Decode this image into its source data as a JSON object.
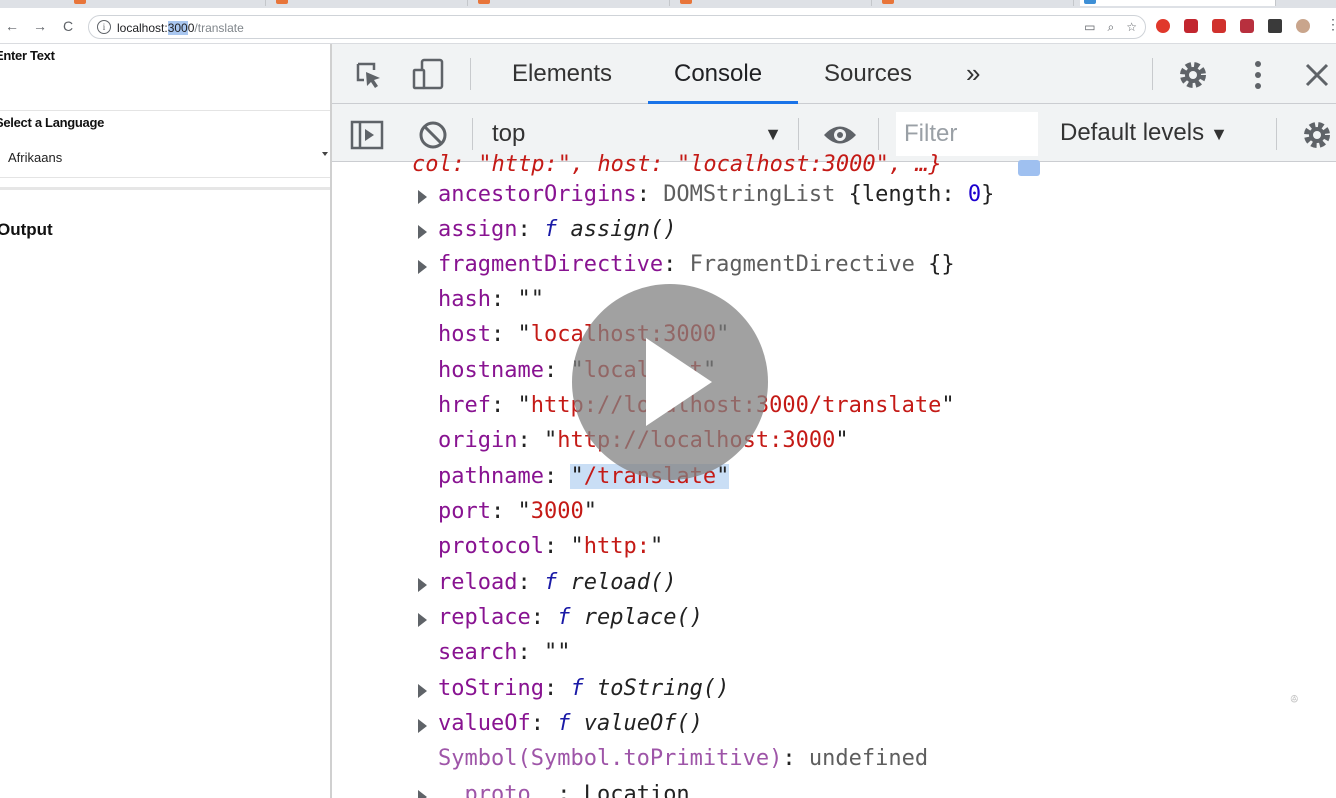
{
  "browser": {
    "url_host": "localhost:",
    "url_port": "300",
    "url_port_tail": "0",
    "url_path": "/translate"
  },
  "page": {
    "enter_text_label": "Enter Text",
    "select_language_label": "Select a Language",
    "language_value": "Afrikaans",
    "output_heading": "Output"
  },
  "devtools": {
    "tabs": [
      "Elements",
      "Console",
      "Sources"
    ],
    "more_tabs": "»",
    "context": "top",
    "filter_placeholder": "Filter",
    "levels_label": "Default levels",
    "console_lines": {
      "partial": "col: \"http:\", host: \"localhost:3000\", …}",
      "ancestorOrigins_key": "ancestorOrigins",
      "ancestorOrigins_type": "DOMStringList",
      "ancestorOrigins_len_key": "length",
      "ancestorOrigins_len_val": "0",
      "assign_key": "assign",
      "assign_fn": "assign()",
      "fragment_key": "fragmentDirective",
      "fragment_val": "FragmentDirective",
      "hash_key": "hash",
      "hash_val": "\"\"",
      "host_key": "host",
      "host_val": "localhost:3000",
      "hostname_key": "hostname",
      "hostname_val": "localhost",
      "href_key": "href",
      "href_val": "http://localhost:3000/translate",
      "origin_key": "origin",
      "origin_val": "http://localhost:3000",
      "pathname_key": "pathname",
      "pathname_val": "/translate",
      "port_key": "port",
      "port_val": "3000",
      "protocol_key": "protocol",
      "protocol_val": "http:",
      "reload_key": "reload",
      "reload_fn": "reload()",
      "replace_key": "replace",
      "replace_fn": "replace()",
      "search_key": "search",
      "search_val": "\"\"",
      "toString_key": "toString",
      "toString_fn": "toString()",
      "valueOf_key": "valueOf",
      "valueOf_fn": "valueOf()",
      "symbol_key": "Symbol(Symbol.toPrimitive)",
      "symbol_val": "undefined",
      "proto_key": "__proto__",
      "proto_val": "Location"
    }
  }
}
